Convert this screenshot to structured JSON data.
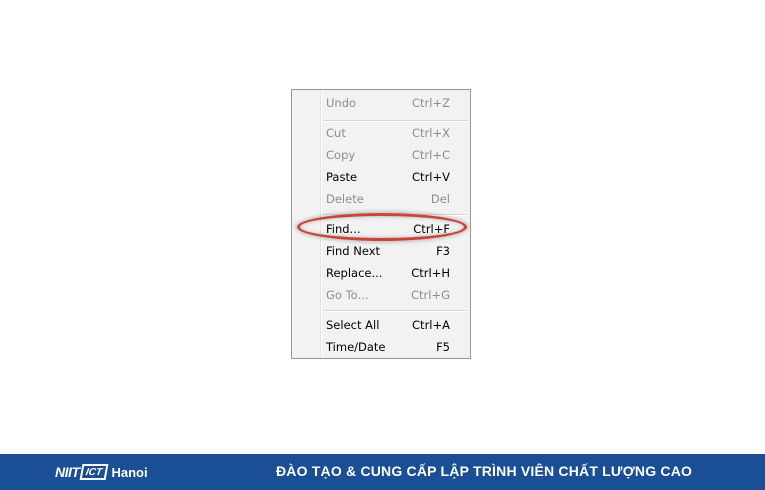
{
  "menu": {
    "items": [
      {
        "label": "Undo",
        "shortcut": "Ctrl+Z",
        "enabled": false
      },
      {
        "label": "Cut",
        "shortcut": "Ctrl+X",
        "enabled": false
      },
      {
        "label": "Copy",
        "shortcut": "Ctrl+C",
        "enabled": false
      },
      {
        "label": "Paste",
        "shortcut": "Ctrl+V",
        "enabled": true
      },
      {
        "label": "Delete",
        "shortcut": "Del",
        "enabled": false
      },
      {
        "label": "Find...",
        "shortcut": "Ctrl+F",
        "enabled": true,
        "highlighted": true
      },
      {
        "label": "Find Next",
        "shortcut": "F3",
        "enabled": true
      },
      {
        "label": "Replace...",
        "shortcut": "Ctrl+H",
        "enabled": true
      },
      {
        "label": "Go To...",
        "shortcut": "Ctrl+G",
        "enabled": false
      },
      {
        "label": "Select All",
        "shortcut": "Ctrl+A",
        "enabled": true
      },
      {
        "label": "Time/Date",
        "shortcut": "F5",
        "enabled": true
      }
    ]
  },
  "colors": {
    "highlight_ring": "#c9453a",
    "footer_background": "#1a4f96"
  },
  "footer": {
    "logo_text": "NIIT",
    "logo_box_text": "ICT",
    "logo_city": "Hanoi",
    "slogan": "ĐÀO TẠO & CUNG CẤP LẬP TRÌNH VIÊN CHẤT LƯỢNG CAO"
  }
}
